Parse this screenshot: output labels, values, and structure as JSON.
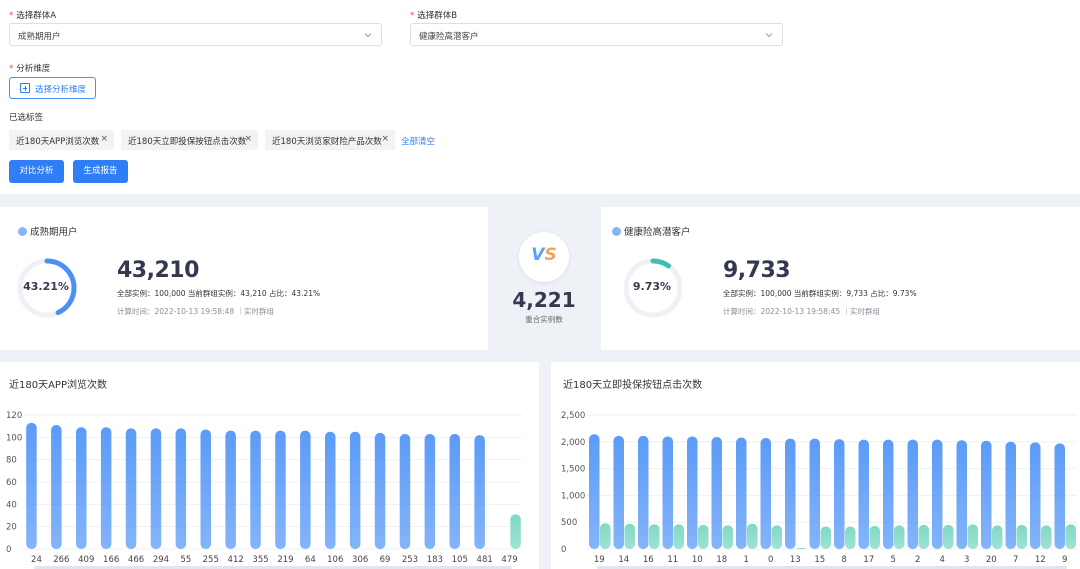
{
  "form": {
    "group_a": {
      "label": "选择群体A",
      "value": "成熟期用户"
    },
    "group_b": {
      "label": "选择群体B",
      "value": "健康险高潜客户"
    },
    "dimension": {
      "label": "分析维度",
      "button": "选择分析维度"
    },
    "selected_label": "已选标签",
    "tags": [
      "近180天APP浏览次数",
      "近180天立即投保按钮点击次数",
      "近180天浏览家财险产品次数"
    ],
    "clear_all": "全部清空",
    "compare_button": "对比分析",
    "report_button": "生成报告",
    "required_mark": "*",
    "tag_close": "×"
  },
  "left_card": {
    "title": "成熟期用户",
    "percent_label": "43.21%",
    "ratio": 0.4321,
    "count": "43,210",
    "meta": "全部实例：100,000 当前群组实例：43,210 占比：43.21%",
    "time": "计算时间：2022-10-13 19:58:48 ｜实时群组",
    "ring_color": "#4a90f6"
  },
  "right_card": {
    "title": "健康险高潜客户",
    "percent_label": "9.73%",
    "ratio": 0.0973,
    "count": "9,733",
    "meta": "全部实例：100,000 当前群组实例：9,733 占比：9.73%",
    "time": "计算时间：2022-10-13 19:58:45 ｜实时群组",
    "ring_color": "#3fbdb5"
  },
  "vs": {
    "v": "V",
    "s": "S",
    "overlap": "4,221",
    "overlap_label": "重合实例数"
  },
  "chart_data": [
    {
      "type": "bar",
      "title": "近180天APP浏览次数",
      "categories": [
        "24",
        "266",
        "409",
        "166",
        "466",
        "294",
        "55",
        "255",
        "412",
        "355",
        "219",
        "64",
        "106",
        "306",
        "69",
        "253",
        "183",
        "105",
        "481",
        "479"
      ],
      "series": [
        {
          "values": [
            113,
            111,
            109,
            109,
            108,
            108,
            108,
            107,
            106,
            106,
            106,
            106,
            105,
            105,
            104,
            103,
            103,
            103,
            102,
            0
          ]
        },
        {
          "values": [
            0,
            0,
            0,
            0,
            0,
            0,
            0,
            0,
            0,
            0,
            0,
            0,
            0,
            0,
            0,
            0,
            0,
            0,
            0,
            31
          ]
        }
      ],
      "yticks": [
        "0",
        "20",
        "40",
        "60",
        "80",
        "100",
        "120"
      ],
      "ylim": [
        0,
        120
      ],
      "colors": [
        "#5b9bf8",
        "#7fd9c4"
      ]
    },
    {
      "type": "bar",
      "title": "近180天立即投保按钮点击次数",
      "categories": [
        "19",
        "14",
        "16",
        "11",
        "10",
        "18",
        "1",
        "0",
        "13",
        "15",
        "8",
        "17",
        "5",
        "2",
        "4",
        "3",
        "20",
        "7",
        "12",
        "9"
      ],
      "series": [
        {
          "values": [
            2140,
            2110,
            2110,
            2100,
            2100,
            2090,
            2080,
            2070,
            2060,
            2060,
            2050,
            2040,
            2040,
            2040,
            2040,
            2030,
            2020,
            2000,
            1990,
            1970
          ]
        },
        {
          "values": [
            480,
            470,
            460,
            460,
            450,
            440,
            470,
            440,
            20,
            420,
            420,
            430,
            440,
            450,
            450,
            460,
            440,
            450,
            440,
            460
          ]
        }
      ],
      "yticks": [
        "0",
        "500",
        "1,000",
        "1,500",
        "2,000",
        "2,500"
      ],
      "ylim": [
        0,
        2500
      ],
      "colors": [
        "#5b9bf8",
        "#7fd9c4"
      ]
    }
  ]
}
